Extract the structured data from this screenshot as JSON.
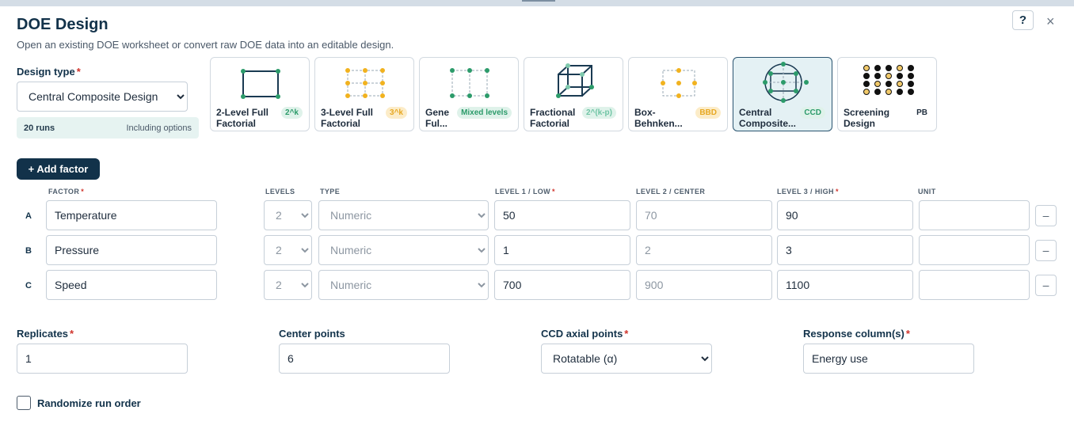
{
  "header": {
    "title": "DOE Design",
    "subtitle": "Open an existing DOE worksheet or convert raw DOE data into an editable design.",
    "help_label": "?",
    "close_label": "×"
  },
  "design_type": {
    "label": "Design type",
    "required_mark": "*",
    "selected": "Central Composite Design",
    "runs": "20 runs",
    "runs_note": "Including options"
  },
  "design_cards": [
    {
      "name": "2-Level Full Factorial",
      "badge": "2^k",
      "badge_color": "green"
    },
    {
      "name": "3-Level Full Factorial",
      "badge": "3^k",
      "badge_color": "yellow"
    },
    {
      "name": "Gene Ful...",
      "badge": "Mixed levels",
      "badge_color": "green"
    },
    {
      "name": "Fractional Factorial",
      "badge": "2^(k-p)",
      "badge_color": "green"
    },
    {
      "name": "Box-Behnken...",
      "badge": "BBD",
      "badge_color": "yellow"
    },
    {
      "name": "Central Composite...",
      "badge": "CCD",
      "badge_color": "green",
      "selected": true
    },
    {
      "name": "Screening Design",
      "badge": "PB",
      "badge_color": "plain"
    }
  ],
  "colors": {
    "navy": "#12324a",
    "green": "#2c9b6a",
    "yellow": "#f1b21f",
    "teal_bg": "#e6f3f1"
  },
  "add_factor_label": "+ Add factor",
  "columns": {
    "factor": "FACTOR",
    "levels": "LEVELS",
    "type": "TYPE",
    "level1": "LEVEL 1 / LOW",
    "level2": "LEVEL 2 / CENTER",
    "level3": "LEVEL 3 / HIGH",
    "unit": "UNIT",
    "required_mark": "*"
  },
  "factors": [
    {
      "id": "A",
      "name": "Temperature",
      "levels": "2",
      "type": "Numeric",
      "low": "50",
      "center": "70",
      "high": "90",
      "unit": "",
      "remove": "–"
    },
    {
      "id": "B",
      "name": "Pressure",
      "levels": "2",
      "type": "Numeric",
      "low": "1",
      "center": "2",
      "high": "3",
      "unit": "",
      "remove": "–"
    },
    {
      "id": "C",
      "name": "Speed",
      "levels": "2",
      "type": "Numeric",
      "low": "700",
      "center": "900",
      "high": "1100",
      "unit": "",
      "remove": "–"
    }
  ],
  "options": {
    "replicates_label": "Replicates",
    "replicates": "1",
    "center_points_label": "Center points",
    "center_points": "6",
    "axial_label": "CCD axial points",
    "axial": "Rotatable (α)",
    "response_label": "Response column(s)",
    "response": "Energy use",
    "required_mark": "*"
  },
  "randomize_label": "Randomize run order"
}
